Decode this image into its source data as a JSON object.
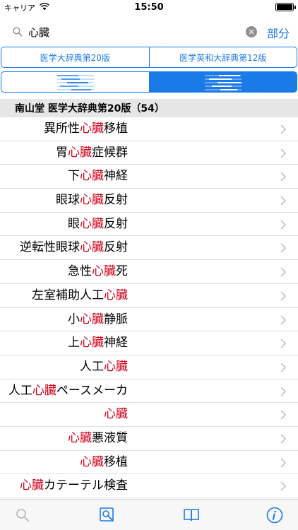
{
  "status_bar": {
    "carrier": "キャリア",
    "time": "15:50"
  },
  "search": {
    "query": "心臓",
    "cancel_label": "部分"
  },
  "dictionaries": [
    "医学大辞典第20版",
    "医学英和大辞典第12版"
  ],
  "section": {
    "title": "南山堂 医学大辞典第20版（54）"
  },
  "results": [
    {
      "before": "異所性",
      "match": "心臓",
      "after": "移植"
    },
    {
      "before": "胃",
      "match": "心臓",
      "after": "症候群"
    },
    {
      "before": "下",
      "match": "心臓",
      "after": "神経"
    },
    {
      "before": "眼球",
      "match": "心臓",
      "after": "反射"
    },
    {
      "before": "眼",
      "match": "心臓",
      "after": "反射"
    },
    {
      "before": "逆転性眼球",
      "match": "心臓",
      "after": "反射"
    },
    {
      "before": "急性",
      "match": "心臓",
      "after": "死"
    },
    {
      "before": "左室補助人工",
      "match": "心臓",
      "after": ""
    },
    {
      "before": "小",
      "match": "心臓",
      "after": "静脈"
    },
    {
      "before": "上",
      "match": "心臓",
      "after": "神経"
    },
    {
      "before": "人工",
      "match": "心臓",
      "after": ""
    },
    {
      "before": "人工",
      "match": "心臓",
      "after": "ペースメーカ"
    },
    {
      "before": "",
      "match": "心臓",
      "after": ""
    },
    {
      "before": "",
      "match": "心臓",
      "after": "悪液質"
    },
    {
      "before": "",
      "match": "心臓",
      "after": "移植"
    },
    {
      "before": "",
      "match": "心臓",
      "after": "カテーテル検査"
    }
  ],
  "colors": {
    "accent": "#1a7ae8",
    "highlight": "#d0021b"
  },
  "icons": [
    "wifi-icon",
    "battery-icon",
    "search-icon",
    "clear-icon",
    "chevron-right-icon",
    "tab-search-icon",
    "tab-image-search-icon",
    "tab-book-icon",
    "tab-info-icon"
  ]
}
